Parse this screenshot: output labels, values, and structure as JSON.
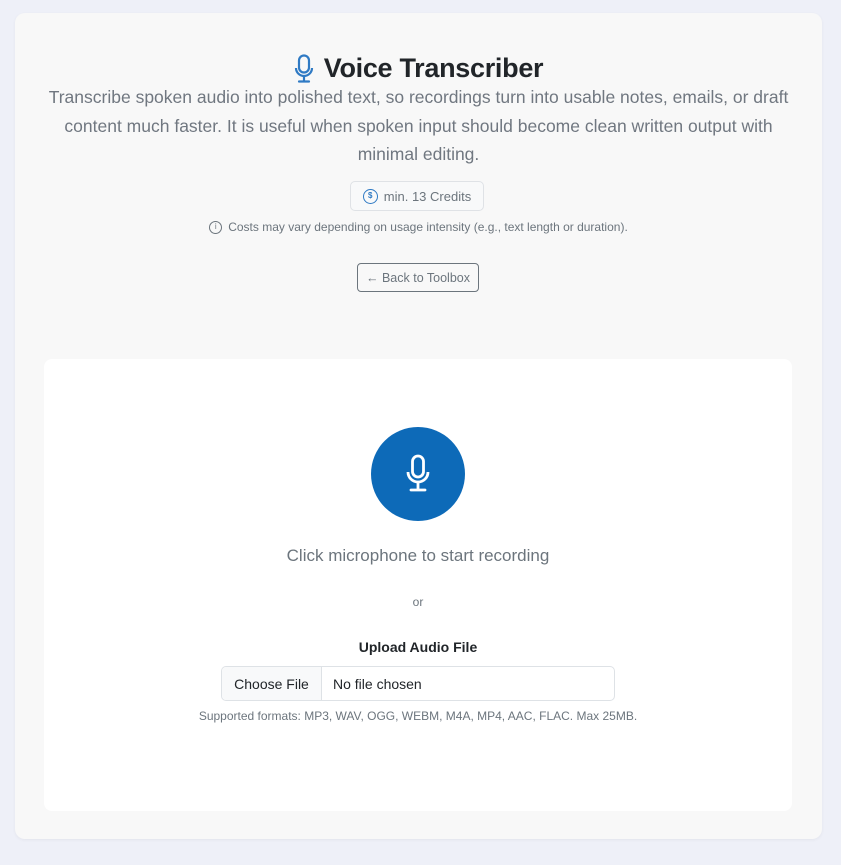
{
  "header": {
    "title": "Voice Transcriber",
    "icon": "microphone-icon",
    "description": "Transcribe spoken audio into polished text, so recordings turn into usable notes, emails, or draft content much faster. It is useful when spoken input should become clean written output with minimal editing."
  },
  "credits": {
    "icon_glyph": "$",
    "label": "min. 13 Credits"
  },
  "cost_note": {
    "icon_glyph": "i",
    "text": "Costs may vary depending on usage intensity (e.g., text length or duration)."
  },
  "back_button": {
    "label": "← Back to Toolbox"
  },
  "recorder": {
    "hint": "Click microphone to start recording",
    "or_text": "or"
  },
  "upload": {
    "label": "Upload Audio File",
    "button_label": "Choose File",
    "file_status": "No file chosen",
    "formats_hint": "Supported formats: MP3, WAV, OGG, WEBM, M4A, MP4, AAC, FLAC. Max 25MB."
  },
  "colors": {
    "accent": "#0d6ab8",
    "background": "#eef0f8",
    "card": "#f8f8f8",
    "muted_text": "#6c757d"
  }
}
